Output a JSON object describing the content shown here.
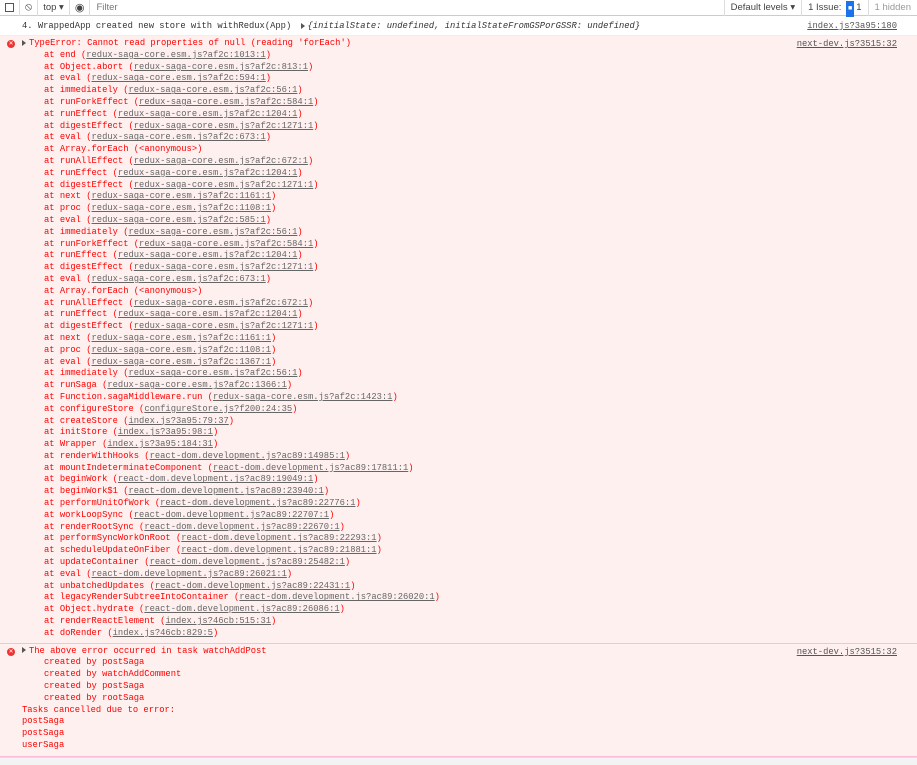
{
  "toolbar": {
    "context": "top",
    "filter_placeholder": "Filter",
    "levels": "Default levels",
    "issues_label": "1 Issue:",
    "issues_count": "1",
    "hidden": "1 hidden"
  },
  "log": {
    "text": "4. WrappedApp created new store with withRedux(App)",
    "object": "{initialState: undefined, initialStateFromGSPorGSSR: undefined}",
    "source": "index.js?3a95:180"
  },
  "error1": {
    "message": "TypeError: Cannot read properties of null (reading 'forEach')",
    "source": "next-dev.js?3515:32",
    "stack": [
      {
        "fn": "end",
        "loc": "redux-saga-core.esm.js?af2c:1013:1"
      },
      {
        "fn": "Object.abort",
        "loc": "redux-saga-core.esm.js?af2c:813:1"
      },
      {
        "fn": "eval",
        "loc": "redux-saga-core.esm.js?af2c:594:1"
      },
      {
        "fn": "immediately",
        "loc": "redux-saga-core.esm.js?af2c:56:1"
      },
      {
        "fn": "runForkEffect",
        "loc": "redux-saga-core.esm.js?af2c:584:1"
      },
      {
        "fn": "runEffect",
        "loc": "redux-saga-core.esm.js?af2c:1204:1"
      },
      {
        "fn": "digestEffect",
        "loc": "redux-saga-core.esm.js?af2c:1271:1"
      },
      {
        "fn": "eval",
        "loc": "redux-saga-core.esm.js?af2c:673:1"
      },
      {
        "fn": "Array.forEach",
        "loc": "<anonymous>",
        "plain": true
      },
      {
        "fn": "runAllEffect",
        "loc": "redux-saga-core.esm.js?af2c:672:1"
      },
      {
        "fn": "runEffect",
        "loc": "redux-saga-core.esm.js?af2c:1204:1"
      },
      {
        "fn": "digestEffect",
        "loc": "redux-saga-core.esm.js?af2c:1271:1"
      },
      {
        "fn": "next",
        "loc": "redux-saga-core.esm.js?af2c:1161:1"
      },
      {
        "fn": "proc",
        "loc": "redux-saga-core.esm.js?af2c:1108:1"
      },
      {
        "fn": "eval",
        "loc": "redux-saga-core.esm.js?af2c:585:1"
      },
      {
        "fn": "immediately",
        "loc": "redux-saga-core.esm.js?af2c:56:1"
      },
      {
        "fn": "runForkEffect",
        "loc": "redux-saga-core.esm.js?af2c:584:1"
      },
      {
        "fn": "runEffect",
        "loc": "redux-saga-core.esm.js?af2c:1204:1"
      },
      {
        "fn": "digestEffect",
        "loc": "redux-saga-core.esm.js?af2c:1271:1"
      },
      {
        "fn": "eval",
        "loc": "redux-saga-core.esm.js?af2c:673:1"
      },
      {
        "fn": "Array.forEach",
        "loc": "<anonymous>",
        "plain": true
      },
      {
        "fn": "runAllEffect",
        "loc": "redux-saga-core.esm.js?af2c:672:1"
      },
      {
        "fn": "runEffect",
        "loc": "redux-saga-core.esm.js?af2c:1204:1"
      },
      {
        "fn": "digestEffect",
        "loc": "redux-saga-core.esm.js?af2c:1271:1"
      },
      {
        "fn": "next",
        "loc": "redux-saga-core.esm.js?af2c:1161:1"
      },
      {
        "fn": "proc",
        "loc": "redux-saga-core.esm.js?af2c:1108:1"
      },
      {
        "fn": "eval",
        "loc": "redux-saga-core.esm.js?af2c:1367:1"
      },
      {
        "fn": "immediately",
        "loc": "redux-saga-core.esm.js?af2c:56:1"
      },
      {
        "fn": "runSaga",
        "loc": "redux-saga-core.esm.js?af2c:1366:1"
      },
      {
        "fn": "Function.sagaMiddleware.run",
        "loc": "redux-saga-core.esm.js?af2c:1423:1"
      },
      {
        "fn": "configureStore",
        "loc": "configureStore.js?f200:24:35"
      },
      {
        "fn": "createStore",
        "loc": "index.js?3a95:79:37"
      },
      {
        "fn": "initStore",
        "loc": "index.js?3a95:98:1"
      },
      {
        "fn": "Wrapper",
        "loc": "index.js?3a95:184:31"
      },
      {
        "fn": "renderWithHooks",
        "loc": "react-dom.development.js?ac89:14985:1"
      },
      {
        "fn": "mountIndeterminateComponent",
        "loc": "react-dom.development.js?ac89:17811:1"
      },
      {
        "fn": "beginWork",
        "loc": "react-dom.development.js?ac89:19049:1"
      },
      {
        "fn": "beginWork$1",
        "loc": "react-dom.development.js?ac89:23940:1"
      },
      {
        "fn": "performUnitOfWork",
        "loc": "react-dom.development.js?ac89:22776:1"
      },
      {
        "fn": "workLoopSync",
        "loc": "react-dom.development.js?ac89:22707:1"
      },
      {
        "fn": "renderRootSync",
        "loc": "react-dom.development.js?ac89:22670:1"
      },
      {
        "fn": "performSyncWorkOnRoot",
        "loc": "react-dom.development.js?ac89:22293:1"
      },
      {
        "fn": "scheduleUpdateOnFiber",
        "loc": "react-dom.development.js?ac89:21881:1"
      },
      {
        "fn": "updateContainer",
        "loc": "react-dom.development.js?ac89:25482:1"
      },
      {
        "fn": "eval",
        "loc": "react-dom.development.js?ac89:26021:1"
      },
      {
        "fn": "unbatchedUpdates",
        "loc": "react-dom.development.js?ac89:22431:1"
      },
      {
        "fn": "legacyRenderSubtreeIntoContainer",
        "loc": "react-dom.development.js?ac89:26020:1"
      },
      {
        "fn": "Object.hydrate",
        "loc": "react-dom.development.js?ac89:26086:1"
      },
      {
        "fn": "renderReactElement",
        "loc": "index.js?46cb:515:31"
      },
      {
        "fn": "doRender",
        "loc": "index.js?46cb:829:5"
      }
    ]
  },
  "error2": {
    "message": "The above error occurred in task watchAddPost",
    "source": "next-dev.js?3515:32",
    "created_by": [
      "created by postSaga",
      "created by watchAddComment",
      "created by postSaga",
      "created by rootSaga"
    ],
    "cancelled_label": "Tasks cancelled due to error:",
    "cancelled": [
      "postSaga",
      "postSaga",
      "userSaga"
    ]
  }
}
